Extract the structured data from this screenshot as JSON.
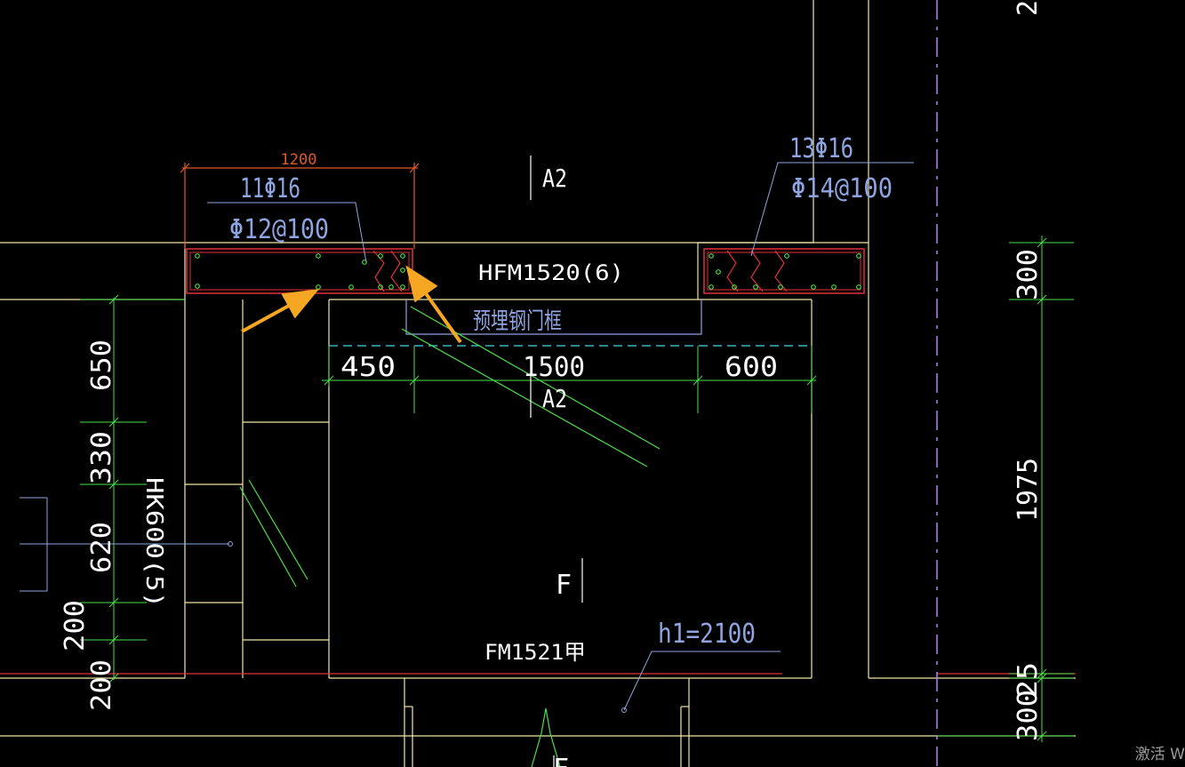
{
  "colors": {
    "background": "#000000",
    "wall": "#f0e6a8",
    "beam_section": "#e0303a",
    "rebar_dot": "#48e048",
    "dimension": "#48e048",
    "leader": "#8ea4e0",
    "annotation_text": "#8ea4e0",
    "door_label": "#ffffff",
    "dimension_text": "#ffffff",
    "header_dimension": "#e05a28",
    "axis_line": "#b080ff",
    "pointer_arrow": "#f5a623"
  },
  "labels": {
    "beam_width_dim": "1200",
    "left_top_rebar": "11Φ16",
    "left_stirrup": "Φ12@100",
    "right_top_rebar": "13Φ16",
    "right_stirrup": "Φ14@100",
    "room_top": "A2",
    "room_mid": "A2",
    "room_f1": "F",
    "room_f2": "F",
    "door_hfm": "HFM1520(6)",
    "embedded_frame": "预埋钢门框",
    "door_fm": "FM1521甲",
    "door_hk": "HK600(5)",
    "h1_label": "h1=2100"
  },
  "dims": {
    "horiz_450": "450",
    "horiz_1500": "1500",
    "horiz_600": "600",
    "vert_650": "650",
    "vert_330": "330",
    "vert_620": "620",
    "vert_200a": "200",
    "vert_200b": "200",
    "right_top_cut": "2",
    "right_300a": "300",
    "right_1975": "1975",
    "right_25": "25",
    "right_300b": "300"
  },
  "watermark": "激活 W"
}
